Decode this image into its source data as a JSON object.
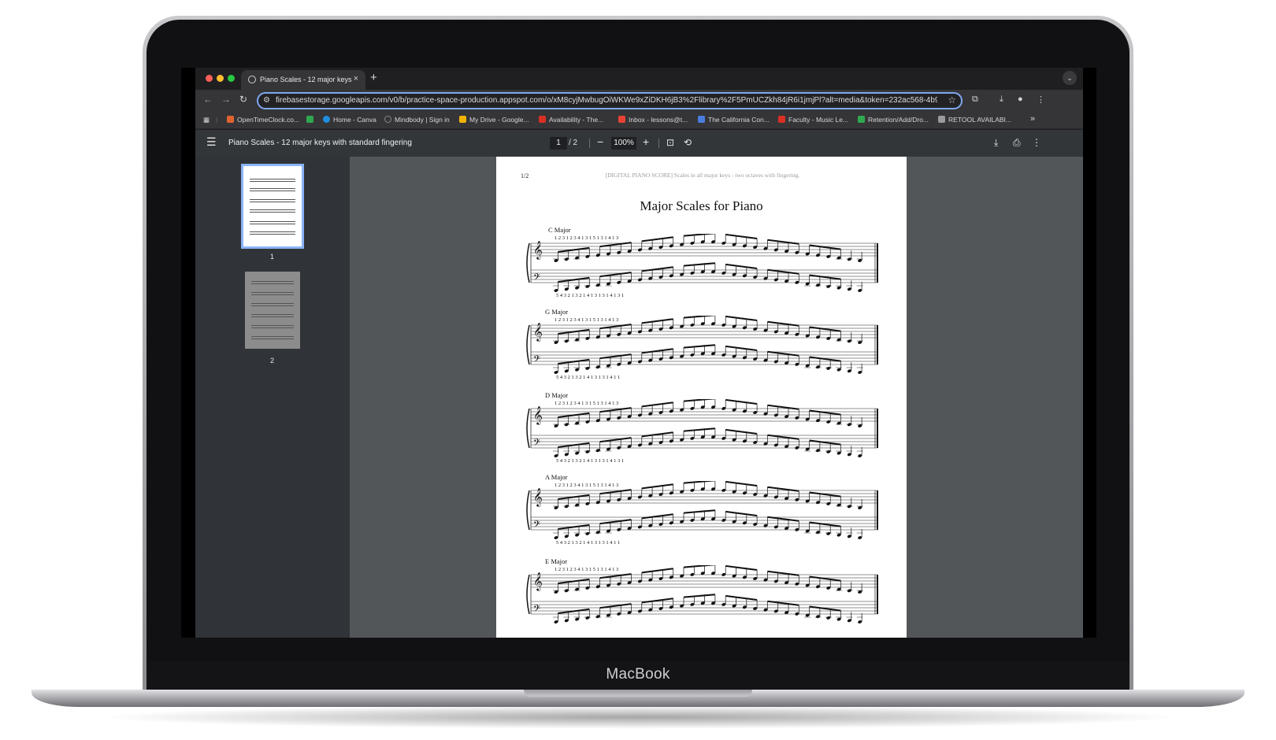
{
  "device": {
    "label": "MacBook"
  },
  "browser": {
    "tab": {
      "title": "Piano Scales - 12 major keys",
      "close": "×"
    },
    "new_tab": "+",
    "nav": {
      "back": "←",
      "forward": "→",
      "reload": "↻"
    },
    "url": "firebasestorage.googleapis.com/v0/b/practice-space-production.appspot.com/o/xM8cyjMwbugOiWKWe9xZiDKH6jB3%2Flibrary%2F5PmUCZkh84jR6i1jmjPl?alt=media&token=232ac568-4b9...",
    "bookmarks": [
      {
        "label": "OpenTimeClock.co...",
        "color": "#e0632f"
      },
      {
        "label": "",
        "color": "#2fa84f"
      },
      {
        "label": "Home - Canva",
        "color": "#1f8de0"
      },
      {
        "label": "Mindbody | Sign in",
        "color": "#777777"
      },
      {
        "label": "My Drive - Google...",
        "color": "#f2b400"
      },
      {
        "label": "Availability - The...",
        "color": "#d93025"
      },
      {
        "label": "Inbox - lessons@t...",
        "color": "#ea4335"
      },
      {
        "label": "The California Con...",
        "color": "#4a7de0"
      },
      {
        "label": "Faculty - Music Le...",
        "color": "#d93025"
      },
      {
        "label": "Retention/Add/Dro...",
        "color": "#2fa84f"
      },
      {
        "label": "RETOOL AVAILABI...",
        "color": "#9a9a9a"
      }
    ],
    "bookmarks_more": "»"
  },
  "pdf": {
    "title": "Piano Scales - 12 major keys with standard fingering",
    "page_current": "1",
    "page_total": "/  2",
    "zoom": "100%",
    "zoom_out": "−",
    "zoom_in": "+",
    "thumbnails": [
      {
        "num": "1"
      },
      {
        "num": "2"
      }
    ],
    "page": {
      "page_label": "1/2",
      "header": "[DIGITAL PIANO SCORE] Scales in all major keys - two octaves with fingering.",
      "title_main": "Major Scales",
      "title_rest": " for Piano",
      "keys": [
        "C Major",
        "G Major",
        "D Major",
        "A Major",
        "E Major"
      ],
      "fingering_rh": [
        "1 2 3 1 2 3 4 1    3 1           5              1 3      1 4          1 3",
        "1 2 3 1 2 3 4 1    3 1           5              1 3      1 4          1 3",
        "1 2 3 1 2 3 4 1    3 1           5              1 3      1 4          1 3",
        "1 2 3 1 2 3 4 1    3 1           5              1 3      1 4          1 3",
        "1 2 3 1 2 3 4 1    3 1           5              1 3      1 4          1 3"
      ],
      "fingering_lh": [
        "5 4 3 2 1 3 2 1 4     1 3     1     3 1      4 1     3 1",
        "5 4 3 2 1 3 2 1 4     1 3     1     3 1      4 1     1",
        "5 4 3 2 1 3 2 1 4     1 3     1     3 1      4 1     3 1",
        "5 4 3 2 1 3 2 1 4     1 3     1     3 1      4 1     1",
        ""
      ]
    }
  }
}
